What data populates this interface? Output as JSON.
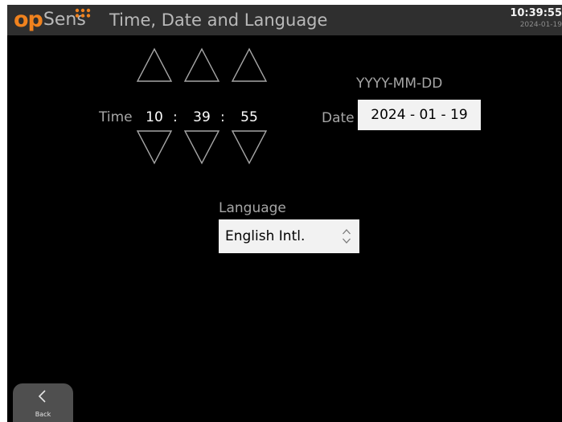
{
  "logo": {
    "part1": "op",
    "part2": "Sens"
  },
  "header": {
    "title": "Time, Date and Language",
    "clock_time": "10:39:55",
    "clock_date": "2024-01-19"
  },
  "time": {
    "label": "Time",
    "hours": "10",
    "minutes": "39",
    "seconds": "55",
    "separator": ":"
  },
  "date": {
    "label": "Date",
    "format_hint": "YYYY-MM-DD",
    "value": "2024 - 01 - 19"
  },
  "language": {
    "label": "Language",
    "selected": "English Intl."
  },
  "back": {
    "label": "Back"
  },
  "colors": {
    "screen_bg": "#000000",
    "header_bg": "#2f2f2f",
    "brand_orange": "#f0821e",
    "label_grey": "#a6a6a6",
    "field_bg": "#f2f2f2",
    "back_button_bg": "#4f4f4f"
  },
  "icons": {
    "time_up": "triangle-up-outline",
    "time_down": "triangle-down-outline",
    "language_select": "up-down-chevron",
    "back": "chevron-left",
    "logo_dots": "three-by-two-dot-grid"
  }
}
